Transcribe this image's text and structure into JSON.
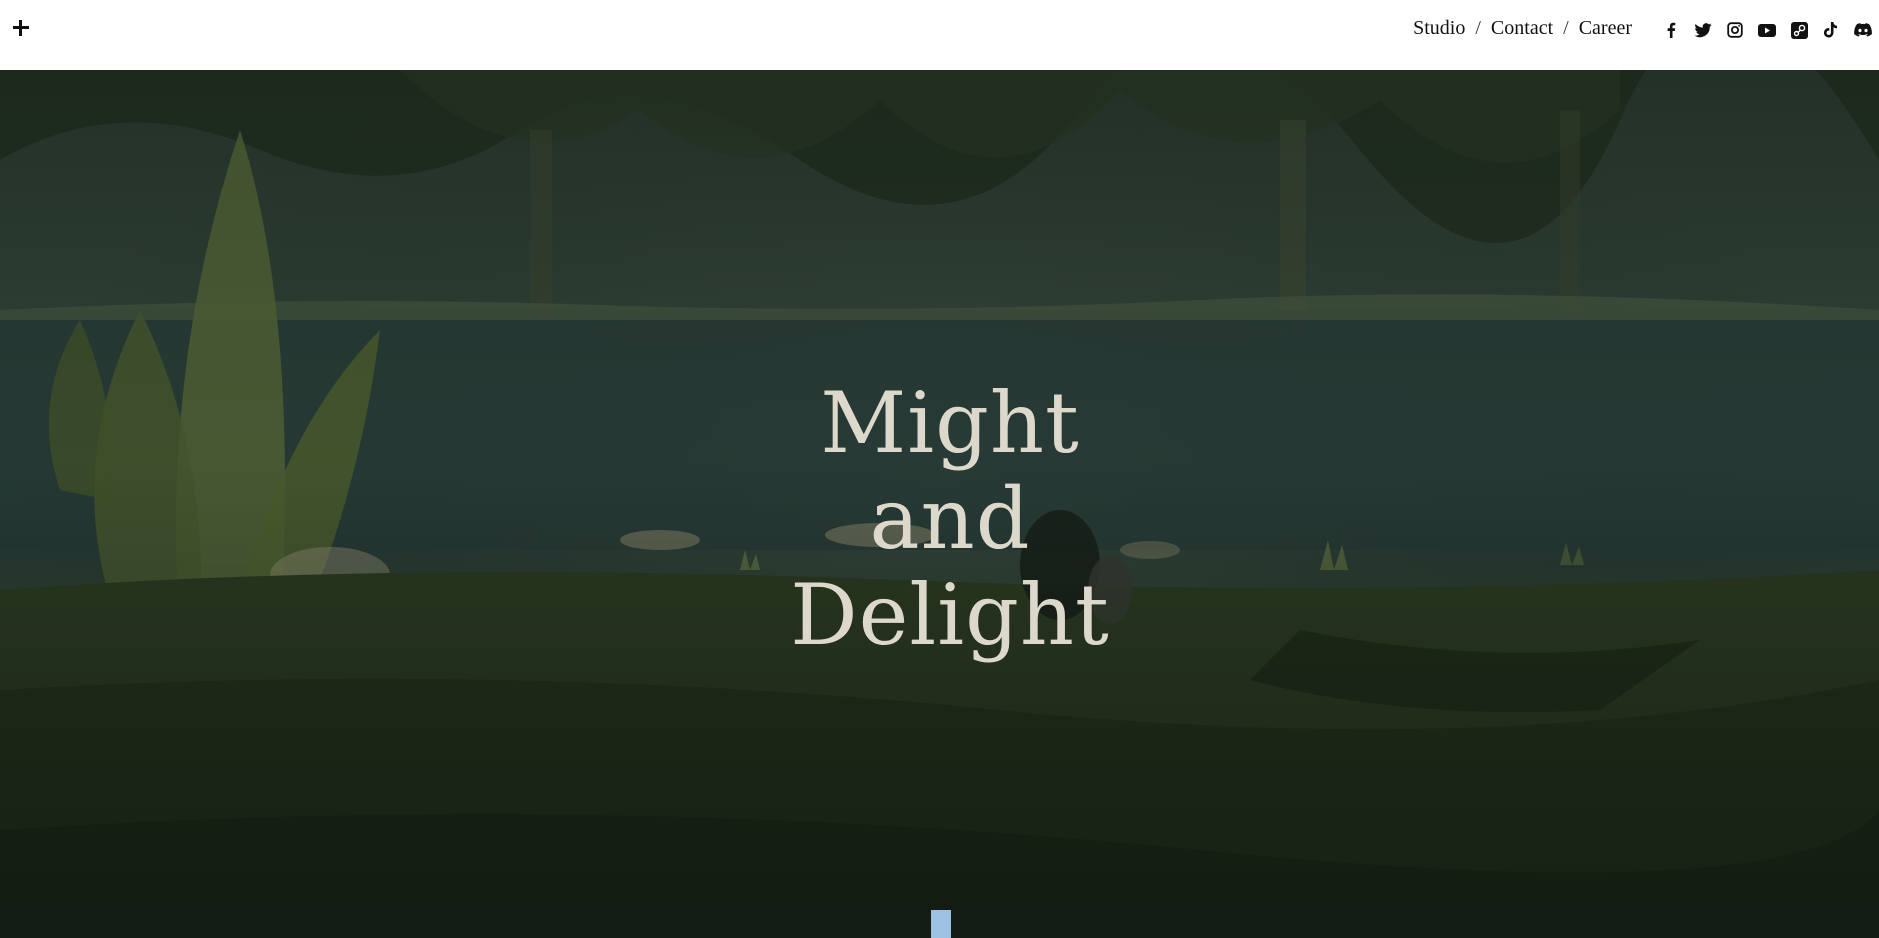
{
  "header": {
    "menu_icon": "plus-icon",
    "nav": [
      {
        "label": "Studio"
      },
      {
        "label": "Contact"
      },
      {
        "label": "Career"
      }
    ],
    "separator": "/",
    "social_icons": [
      "facebook-icon",
      "twitter-icon",
      "instagram-icon",
      "youtube-icon",
      "steam-icon",
      "tiktok-icon",
      "discord-icon"
    ]
  },
  "hero": {
    "title_lines": [
      "Might",
      "and",
      "Delight"
    ],
    "title_color": "#ddd8cc",
    "scroll_indicator_color": "#9cc1e2"
  }
}
